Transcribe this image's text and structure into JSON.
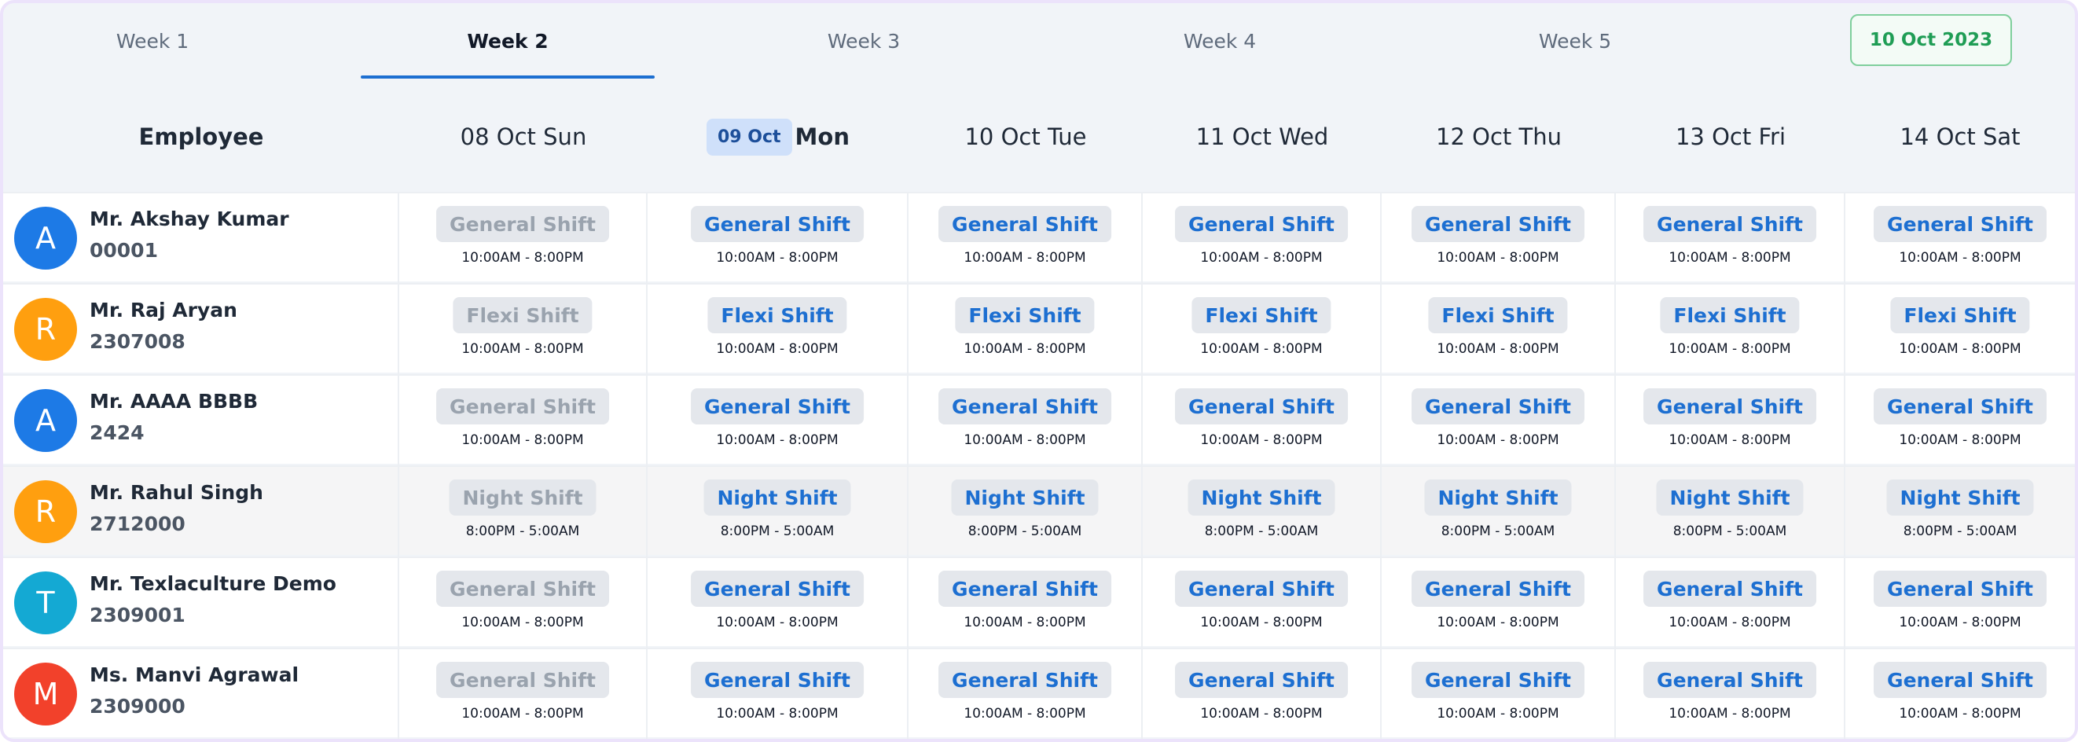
{
  "tabs": [
    {
      "label": "Week 1",
      "active": false
    },
    {
      "label": "Week 2",
      "active": true
    },
    {
      "label": "Week 3",
      "active": false
    },
    {
      "label": "Week 4",
      "active": false
    },
    {
      "label": "Week 5",
      "active": false
    }
  ],
  "today_button": "10 Oct 2023",
  "header": {
    "employee_label": "Employee",
    "days": [
      {
        "label": "08 Oct Sun"
      },
      {
        "badge": "09 Oct",
        "label": "Mon",
        "today": true
      },
      {
        "label": "10 Oct Tue"
      },
      {
        "label": "11 Oct Wed"
      },
      {
        "label": "12 Oct Thu"
      },
      {
        "label": "13 Oct Fri"
      },
      {
        "label": "14 Oct Sat"
      }
    ]
  },
  "colors": {
    "accent": "#1d6fd1",
    "today_green": "#1f9d55",
    "avatar_blue": "#1d7ae6",
    "avatar_orange": "#ff9f0f",
    "avatar_cyan": "#14a9d3",
    "avatar_red": "#f2412b"
  },
  "employees": [
    {
      "initial": "A",
      "name": "Mr. Akshay Kumar",
      "code": "00001",
      "avatar_color": "#1d7ae6",
      "shift": "General Shift",
      "time": "10:00AM - 8:00PM"
    },
    {
      "initial": "R",
      "name": "Mr. Raj Aryan",
      "code": "2307008",
      "avatar_color": "#ff9f0f",
      "shift": "Flexi Shift",
      "time": "10:00AM - 8:00PM"
    },
    {
      "initial": "A",
      "name": "Mr. AAAA BBBB",
      "code": "2424",
      "avatar_color": "#1d7ae6",
      "shift": "General Shift",
      "time": "10:00AM - 8:00PM"
    },
    {
      "initial": "R",
      "name": "Mr. Rahul Singh",
      "code": "2712000",
      "avatar_color": "#ff9f0f",
      "shift": "Night Shift",
      "time": "8:00PM - 5:00AM"
    },
    {
      "initial": "T",
      "name": "Mr. Texlaculture Demo",
      "code": "2309001",
      "avatar_color": "#14a9d3",
      "shift": "General Shift",
      "time": "10:00AM - 8:00PM"
    },
    {
      "initial": "M",
      "name": "Ms. Manvi Agrawal",
      "code": "2309000",
      "avatar_color": "#f2412b",
      "shift": "General Shift",
      "time": "10:00AM - 8:00PM"
    }
  ]
}
